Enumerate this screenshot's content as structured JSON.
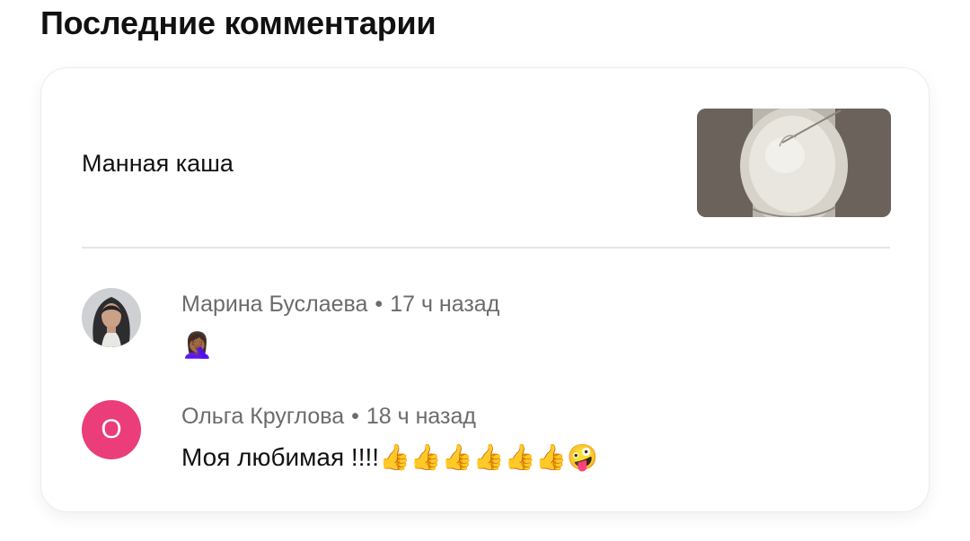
{
  "section": {
    "title": "Последние комментарии"
  },
  "recipe": {
    "title": "Манная каша",
    "thumbnail_icon": "semolina-porridge-photo"
  },
  "comments": [
    {
      "author": "Марина Буслаева",
      "separator": "•",
      "time": "17 ч назад",
      "text": "🤦🏾‍♀️",
      "avatar_type": "photo"
    },
    {
      "author": "Ольга Круглова",
      "separator": "•",
      "time": "18 ч назад",
      "text": "Моя любимая !!!!👍👍👍👍👍👍🤪",
      "avatar_letter": "О",
      "avatar_color": "#ea3d79"
    }
  ]
}
